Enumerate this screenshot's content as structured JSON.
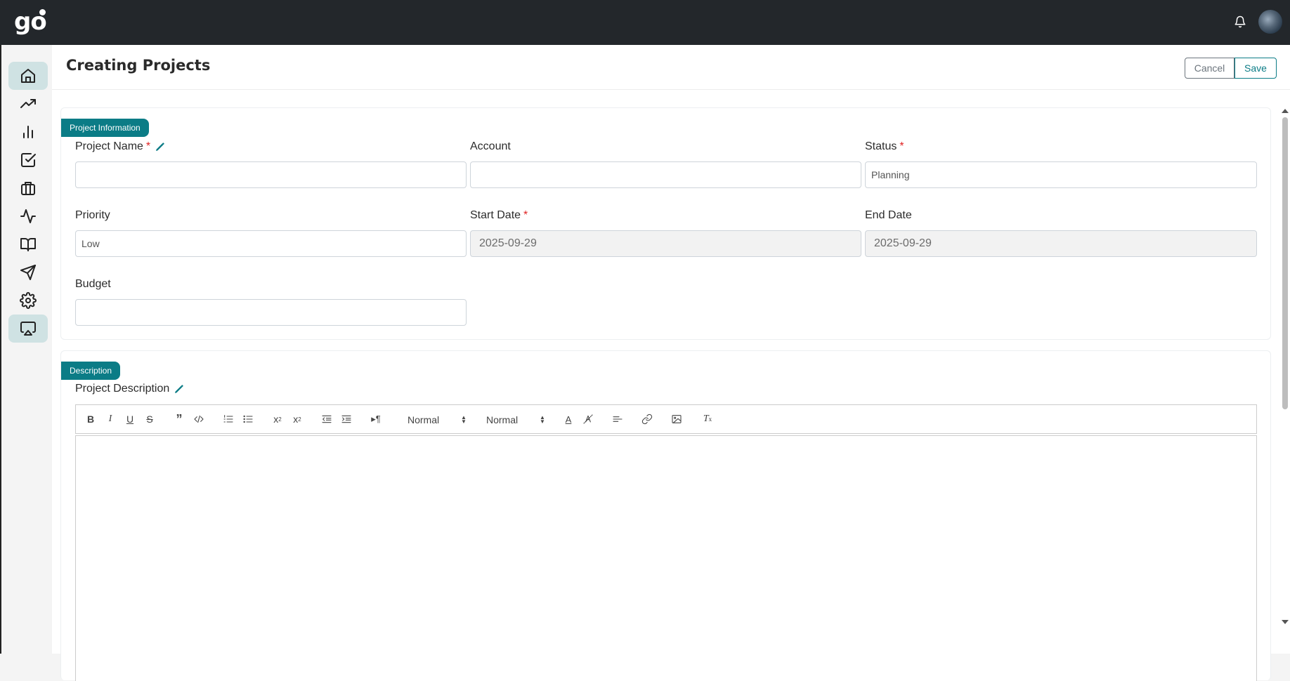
{
  "app": {
    "logo_text": "go"
  },
  "sidebar": {
    "items": [
      {
        "name": "home",
        "icon": "home-icon",
        "active": true
      },
      {
        "name": "trending",
        "icon": "trending-up-icon",
        "active": false
      },
      {
        "name": "analytics",
        "icon": "bar-chart-icon",
        "active": false
      },
      {
        "name": "tasks",
        "icon": "checkbox-icon",
        "active": false
      },
      {
        "name": "projects",
        "icon": "briefcase-icon",
        "active": false
      },
      {
        "name": "activity",
        "icon": "activity-icon",
        "active": false
      },
      {
        "name": "docs",
        "icon": "book-icon",
        "active": false
      },
      {
        "name": "send",
        "icon": "send-icon",
        "active": false
      },
      {
        "name": "settings",
        "icon": "gear-icon",
        "active": false
      },
      {
        "name": "presentations",
        "icon": "airplay-icon",
        "active": true
      }
    ]
  },
  "header": {
    "title": "Creating Projects",
    "cancel_label": "Cancel",
    "save_label": "Save"
  },
  "project_info": {
    "section_label": "Project Information",
    "project_name": {
      "label": "Project Name",
      "value": ""
    },
    "account": {
      "label": "Account",
      "value": ""
    },
    "status": {
      "label": "Status",
      "value": "Planning"
    },
    "priority": {
      "label": "Priority",
      "value": "Low"
    },
    "start_date": {
      "label": "Start Date",
      "value": "2025-09-29"
    },
    "end_date": {
      "label": "End Date",
      "value": "2025-09-29"
    },
    "budget": {
      "label": "Budget",
      "value": ""
    },
    "required_mark": "*"
  },
  "description": {
    "section_label": "Description",
    "project_description_label": "Project Description",
    "toolbar": {
      "header_select": "Normal",
      "size_select": "Normal"
    }
  },
  "colors": {
    "accent": "#0b7c86",
    "topbar": "#23272b",
    "required": "#e02424",
    "sidebar_active": "#cfe2e3"
  }
}
